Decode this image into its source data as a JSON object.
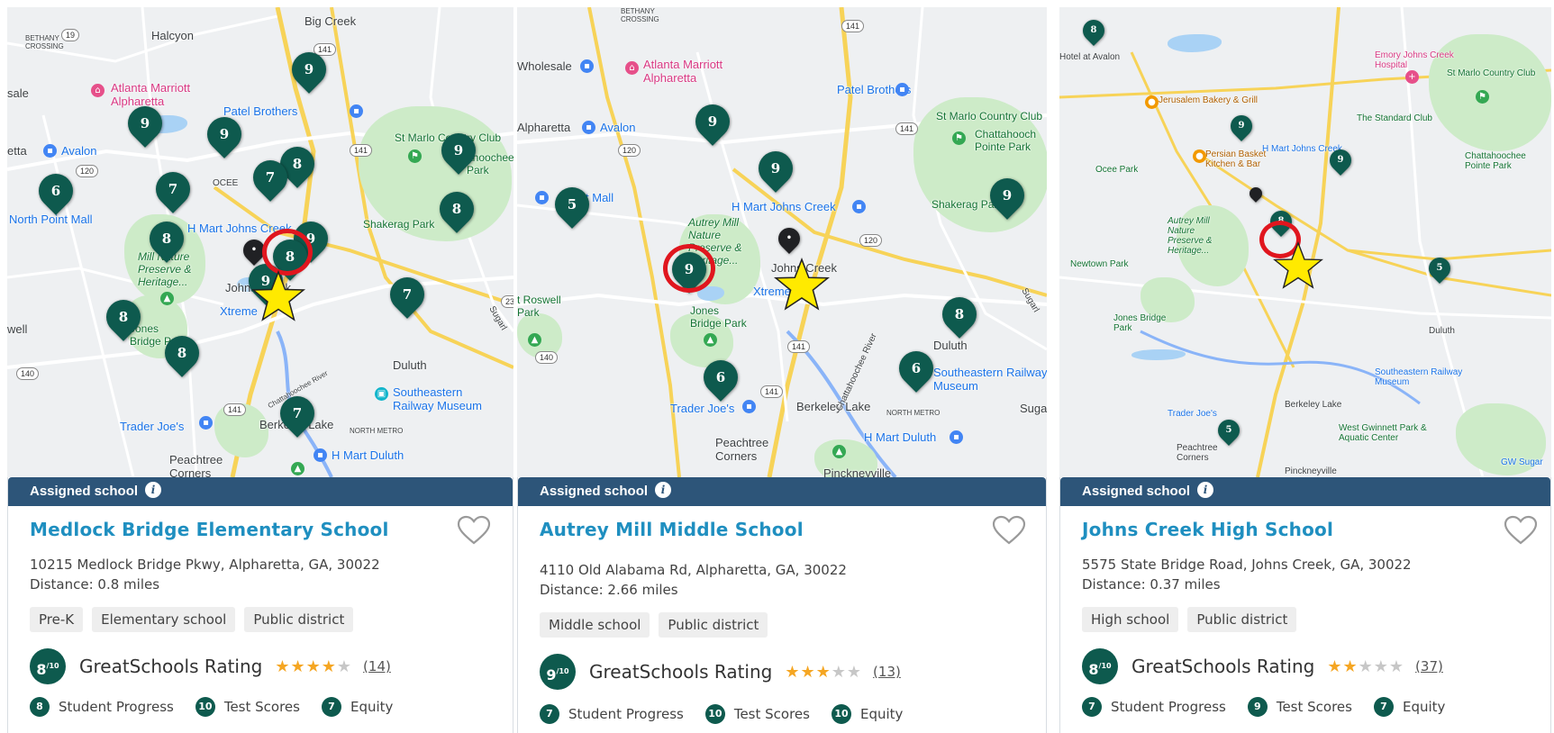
{
  "panels": [
    {
      "map": {
        "labels": {
          "big_creek": "Big Creek",
          "bethany_crossing": "BETHANY CROSSING",
          "halcyon": "Halcyon",
          "marriott": "Atlanta Marriott Alpharetta",
          "patel": "Patel Brothers",
          "avalon": "Avalon",
          "alpharetta": "etta",
          "sale": "sale",
          "ocee": "OCEE",
          "st_marlo": "St Marlo Country Club",
          "chattahoochee": "ahoochee Park",
          "north_point": "North Point Mall",
          "hmart": "H Mart Johns Creek",
          "shakerag": "Shakerag Park",
          "autrey": "Mill Nature Preserve & Heritage...",
          "johns_creek": "Johns Creek",
          "xtreme": "Xtreme",
          "well": "well",
          "jones_bridge": "Jones Bridge Park",
          "duluth": "Duluth",
          "se_railway": "Southeastern Railway Museum",
          "sugarloaf": "Sugarl",
          "trader_joes": "Trader Joe's",
          "berkeley_lake": "Berkeley Lake",
          "north_metro": "NORTH METRO",
          "hmart_duluth": "H Mart Duluth",
          "peachtree": "Peachtree Corners",
          "chatt_river": "Chattahoochee River"
        }
      },
      "card": {
        "header": "Assigned school",
        "name": "Medlock Bridge Elementary School",
        "address": "10215 Medlock Bridge Pkwy, Alpharetta, GA, 30022",
        "distance": "Distance: 0.8 miles",
        "tags": [
          "Pre-K",
          "Elementary school",
          "Public district"
        ],
        "rating": "8",
        "rating_denominator": "/10",
        "rating_title": "GreatSchools Rating",
        "stars": 4,
        "reviews": "(14)",
        "subratings": [
          {
            "value": "8",
            "label": "Student Progress"
          },
          {
            "value": "10",
            "label": "Test Scores"
          },
          {
            "value": "7",
            "label": "Equity"
          }
        ]
      }
    },
    {
      "map": {
        "labels": {
          "bethany_crossing": "BETHANY CROSSING",
          "wholesale": "Wholesale",
          "marriott": "Atlanta Marriott Alpharetta",
          "patel": "Patel Brothers",
          "alpharetta": "Alpharetta",
          "avalon": "Avalon",
          "st_marlo": "St Marlo Country Club",
          "chattahoochee": "Chattahooch Pointe Park",
          "north_point": "Point Mall",
          "hmart": "H Mart Johns Creek",
          "shakerag": "Shakerag Park",
          "autrey": "Autrey Mill Nature Preserve & Heritage...",
          "johns_creek": "Johns Creek",
          "xtreme": "Xtreme",
          "roswell_park": "t Roswell Park",
          "jones_bridge": "Jones Bridge Park",
          "duluth": "Duluth",
          "se_railway": "Southeastern Railway Museum",
          "sugarloaf": "Sugarl",
          "trader_joes": "Trader Joe's",
          "berkeley_lake": "Berkeley Lake",
          "north_metro": "NORTH METRO",
          "hmart_duluth": "H Mart Duluth",
          "peachtree": "Peachtree Corners",
          "pinckneyville": "Pinckneyville",
          "chatt_river": "Chattahoochee River",
          "suga": "Suga"
        }
      },
      "card": {
        "header": "Assigned school",
        "name": "Autrey Mill Middle School",
        "address": "4110 Old Alabama Rd, Alpharetta, GA, 30022",
        "distance": "Distance: 2.66 miles",
        "tags": [
          "Middle school",
          "Public district"
        ],
        "rating": "9",
        "rating_denominator": "/10",
        "rating_title": "GreatSchools Rating",
        "stars": 3,
        "reviews": "(13)",
        "subratings": [
          {
            "value": "7",
            "label": "Student Progress"
          },
          {
            "value": "10",
            "label": "Test Scores"
          },
          {
            "value": "10",
            "label": "Equity"
          }
        ]
      }
    },
    {
      "map": {
        "labels": {
          "hotel_avalon": "Hotel at Avalon",
          "emory": "Emory Johns Creek Hospital",
          "st_marlo": "St Marlo Country Club",
          "jerusalem": "Jerusalem Bakery & Grill",
          "standard_club": "The Standard Club",
          "ocee_park": "Ocee Park",
          "persian": "Persian Basket Kitchen & Bar",
          "hmart": "H Mart Johns Creek",
          "chattahoochee": "Chattahoochee Pointe Park",
          "autrey": "Autrey Mill Nature Preserve & Heritage...",
          "newtown": "Newtown Park",
          "jones_bridge": "Jones Bridge Park",
          "duluth": "Duluth",
          "se_railway": "Southeastern Railway Museum",
          "trader_joes": "Trader Joe's",
          "berkeley_lake": "Berkeley Lake",
          "west_gwinnett": "West Gwinnett Park & Aquatic Center",
          "peachtree": "Peachtree Corners",
          "pinckneyville": "Pinckneyville",
          "gw_sugar": "GW Sugar"
        }
      },
      "card": {
        "header": "Assigned school",
        "name": "Johns Creek High School",
        "address": "5575 State Bridge Road, Johns Creek, GA, 30022",
        "distance": "Distance: 0.37 miles",
        "tags": [
          "High school",
          "Public district"
        ],
        "rating": "8",
        "rating_denominator": "/10",
        "rating_title": "GreatSchools Rating",
        "stars": 2,
        "reviews": "(37)",
        "subratings": [
          {
            "value": "7",
            "label": "Student Progress"
          },
          {
            "value": "9",
            "label": "Test Scores"
          },
          {
            "value": "7",
            "label": "Equity"
          }
        ]
      }
    }
  ],
  "pins": {
    "p0": [
      "9",
      "9",
      "9",
      "9",
      "8",
      "7",
      "6",
      "7",
      "8",
      "8",
      "9",
      "8",
      "9",
      "7",
      "8",
      "8",
      "7"
    ],
    "p1": [
      "9",
      "9",
      "5",
      "9",
      "9",
      "6",
      "8",
      "6"
    ],
    "p2": [
      "8",
      "9",
      "9",
      "8",
      "5",
      "5"
    ]
  },
  "road_shields": {
    "s120": "120",
    "s141": "141",
    "s140": "140",
    "s19": "19",
    "s23": "23"
  },
  "colors": {
    "header": "#2d5579",
    "school_link": "#1f8fc0",
    "rating_badge": "#0e5a4e",
    "star_on": "#f5a623",
    "highlight_ring": "#e0161e",
    "location_star": "#ffea00"
  },
  "icons": [
    "info-icon",
    "heart-icon",
    "star-icon",
    "map-pin-icon",
    "location-star-icon"
  ]
}
